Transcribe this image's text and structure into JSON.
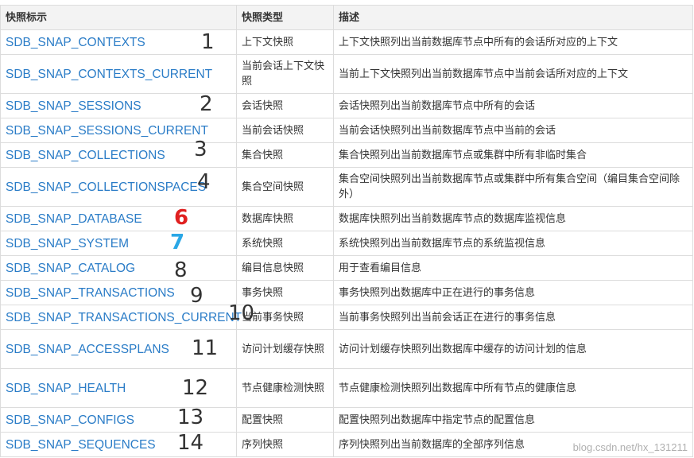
{
  "headers": [
    "快照标示",
    "快照类型",
    "描述"
  ],
  "rows": [
    {
      "name": "SDB_SNAP_CONTEXTS",
      "type": "上下文快照",
      "desc": "上下文快照列出当前数据库节点中所有的会话所对应的上下文",
      "mark": "1"
    },
    {
      "name": "SDB_SNAP_CONTEXTS_CURRENT",
      "type": "当前会话上下文快照",
      "desc": "当前上下文快照列出当前数据库节点中当前会话所对应的上下文",
      "mark": ""
    },
    {
      "name": "SDB_SNAP_SESSIONS",
      "type": "会话快照",
      "desc": "会话快照列出当前数据库节点中所有的会话",
      "mark": "2"
    },
    {
      "name": "SDB_SNAP_SESSIONS_CURRENT",
      "type": "当前会话快照",
      "desc": "当前会话快照列出当前数据库节点中当前的会话",
      "mark": ""
    },
    {
      "name": "SDB_SNAP_COLLECTIONS",
      "type": "集合快照",
      "desc": "集合快照列出当前数据库节点或集群中所有非临时集合",
      "mark": "3"
    },
    {
      "name": "SDB_SNAP_COLLECTIONSPACES",
      "type": "集合空间快照",
      "desc": "集合空间快照列出当前数据库节点或集群中所有集合空间（编目集合空间除外）",
      "mark": "4"
    },
    {
      "name": "SDB_SNAP_DATABASE",
      "type": "数据库快照",
      "desc": "数据库快照列出当前数据库节点的数据库监视信息",
      "mark": "6"
    },
    {
      "name": "SDB_SNAP_SYSTEM",
      "type": "系统快照",
      "desc": "系统快照列出当前数据库节点的系统监视信息",
      "mark": "7"
    },
    {
      "name": "SDB_SNAP_CATALOG",
      "type": "编目信息快照",
      "desc": "用于查看编目信息",
      "mark": "8"
    },
    {
      "name": "SDB_SNAP_TRANSACTIONS",
      "type": "事务快照",
      "desc": "事务快照列出数据库中正在进行的事务信息",
      "mark": "9"
    },
    {
      "name": "SDB_SNAP_TRANSACTIONS_CURRENT",
      "type": "当前事务快照",
      "desc": "当前事务快照列出当前会话正在进行的事务信息",
      "mark": "10"
    },
    {
      "name": "SDB_SNAP_ACCESSPLANS",
      "type": "访问计划缓存快照",
      "desc": "访问计划缓存快照列出数据库中缓存的访问计划的信息",
      "mark": "11"
    },
    {
      "name": "SDB_SNAP_HEALTH",
      "type": "节点健康检测快照",
      "desc": "节点健康检测快照列出数据库中所有节点的健康信息",
      "mark": "12"
    },
    {
      "name": "SDB_SNAP_CONFIGS",
      "type": "配置快照",
      "desc": "配置快照列出数据库中指定节点的配置信息",
      "mark": "13"
    },
    {
      "name": "SDB_SNAP_SEQUENCES",
      "type": "序列快照",
      "desc": "序列快照列出当前数据库的全部序列信息",
      "mark": "14"
    }
  ],
  "watermark": "blog.csdn.net/hx_131211",
  "colors": {
    "link": "#2a7cc7",
    "mark_red": "#e02020",
    "mark_blue": "#2aa7e6"
  }
}
